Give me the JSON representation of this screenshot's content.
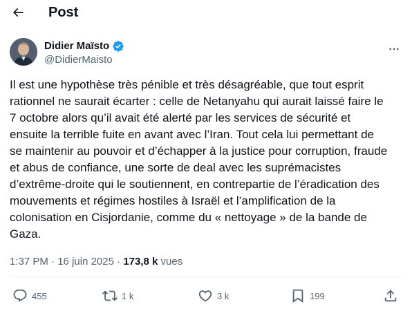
{
  "header": {
    "title": "Post",
    "back_icon": "arrow-left-icon"
  },
  "author": {
    "display_name": "Didier Maïsto",
    "handle": "@DidierMaisto",
    "verified_icon": "verified-badge-icon",
    "verified_color": "#1d9bf0"
  },
  "post": {
    "text": "Il est une hypothèse très pénible et très désagréable, que tout esprit\nrationnel ne saurait écarter : celle de Netanyahu qui aurait laissé faire le\n7 octobre alors qu’il avait été alerté par les services de sécurité et\nensuite la terrible fuite en avant avec l’Iran. Tout cela lui permettant de\nse maintenir au pouvoir et d’échapper à la justice pour corruption, fraude\net abus de confiance, une sorte de deal avec les suprémacistes\nd’extrême-droite qui le soutiennent, en contrepartie de l’éradication des\nmouvements et régimes hostiles à Israël et l’amplification de la\ncolonisation en Cisjordanie, comme du « nettoyage » de la bande de\nGaza."
  },
  "meta": {
    "time": "1:37 PM",
    "separator": "·",
    "date": "16 juin 2025",
    "views_count": "173,8 k",
    "views_label": "vues"
  },
  "actions": {
    "replies": "455",
    "reposts": "1 k",
    "likes": "3 k",
    "bookmarks": "199"
  },
  "colors": {
    "text": "#0f1419",
    "secondary": "#536471",
    "divider": "#eff3f4"
  }
}
